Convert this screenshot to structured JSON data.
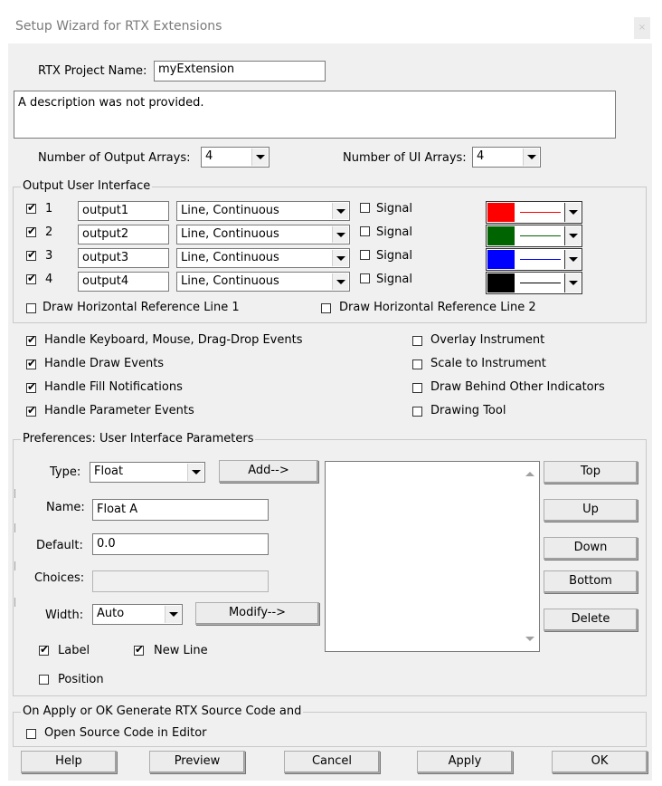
{
  "window": {
    "title": "Setup Wizard for RTX Extensions",
    "close_glyph": "×"
  },
  "project": {
    "name_label": "RTX Project Name:",
    "name_value": "myExtension",
    "description": "A description was not provided."
  },
  "arrays": {
    "output_label": "Number of Output Arrays:",
    "output_value": "4",
    "ui_label": "Number of UI Arrays:",
    "ui_value": "4"
  },
  "output_ui": {
    "group_label": "Output User Interface",
    "rows": [
      {
        "number": "1",
        "checked": true,
        "name": "output1",
        "style": "Line, Continuous",
        "signal_label": "Signal",
        "signal": false,
        "color": "#ff0000"
      },
      {
        "number": "2",
        "checked": true,
        "name": "output2",
        "style": "Line, Continuous",
        "signal_label": "Signal",
        "signal": false,
        "color": "#006400"
      },
      {
        "number": "3",
        "checked": true,
        "name": "output3",
        "style": "Line, Continuous",
        "signal_label": "Signal",
        "signal": false,
        "color": "#0000ff"
      },
      {
        "number": "4",
        "checked": true,
        "name": "output4",
        "style": "Line, Continuous",
        "signal_label": "Signal",
        "signal": false,
        "color": "#000000"
      }
    ],
    "ref_line_1": "Draw Horizontal Reference Line 1",
    "ref_line_2": "Draw Horizontal Reference Line 2"
  },
  "options_left": [
    {
      "label": "Handle Keyboard, Mouse, Drag-Drop Events",
      "checked": true
    },
    {
      "label": "Handle Draw Events",
      "checked": true
    },
    {
      "label": "Handle Fill Notifications",
      "checked": true
    },
    {
      "label": "Handle Parameter Events",
      "checked": true
    }
  ],
  "options_right": [
    {
      "label": "Overlay Instrument",
      "checked": false
    },
    {
      "label": "Scale to Instrument",
      "checked": false
    },
    {
      "label": "Draw Behind Other Indicators",
      "checked": false
    },
    {
      "label": "Drawing Tool",
      "checked": false
    }
  ],
  "preferences": {
    "group_label": "Preferences:  User Interface Parameters",
    "type_label": "Type:",
    "type_value": "Float",
    "add_button": "Add-->",
    "name_label": "Name:",
    "name_value": "Float A",
    "default_label": "Default:",
    "default_value": "0.0",
    "choices_label": "Choices:",
    "choices_value": "",
    "width_label": "Width:",
    "width_value": "Auto",
    "modify_button": "Modify-->",
    "label_check": "Label",
    "label_checked": true,
    "newline_check": "New Line",
    "newline_checked": true,
    "position_check": "Position",
    "position_checked": false,
    "top_button": "Top",
    "up_button": "Up",
    "down_button": "Down",
    "bottom_button": "Bottom",
    "delete_button": "Delete"
  },
  "generate": {
    "group_label": "On Apply or OK Generate RTX Source Code and",
    "open_editor": "Open Source Code in Editor",
    "open_editor_checked": false
  },
  "footer": {
    "help": "Help",
    "preview": "Preview",
    "cancel": "Cancel",
    "apply": "Apply",
    "ok": "OK"
  },
  "check_glyph": "✔"
}
